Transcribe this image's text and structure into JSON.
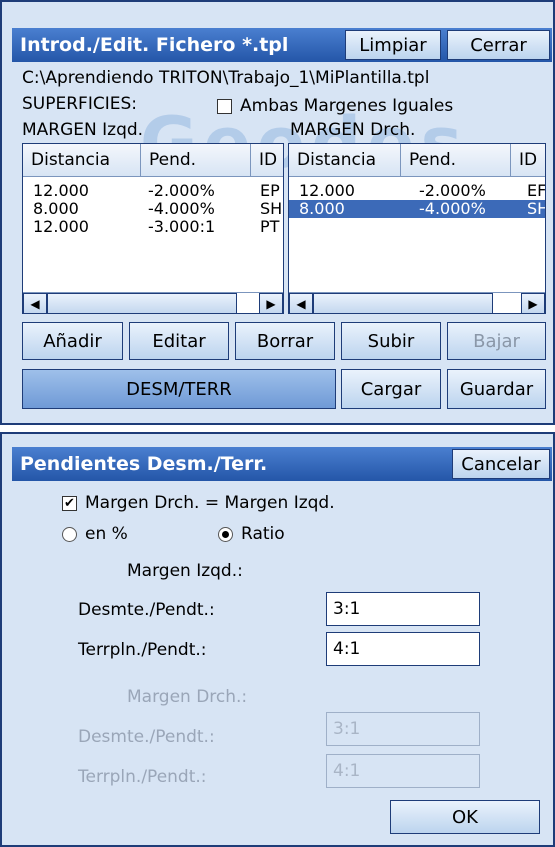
{
  "top_dialog": {
    "title": "Introd./Edit. Fichero *.tpl",
    "limpiar_label": "Limpiar",
    "cerrar_label": "Cerrar",
    "file_path": "C:\\Aprendiendo TRITON\\Trabajo_1\\MiPlantilla.tpl",
    "superficies_label": "SUPERFICIES:",
    "ambas_margenes_label": "Ambas Margenes Iguales",
    "ambas_margenes_checked": false,
    "watermark": "Geodes",
    "left_list": {
      "title": "MARGEN Izqd.",
      "columns": [
        "Distancia",
        "Pend.",
        "ID"
      ],
      "rows": [
        [
          "12.000",
          "-2.000%",
          "EP"
        ],
        [
          "8.000",
          "-4.000%",
          "SH"
        ],
        [
          "12.000",
          "-3.000:1",
          "PT"
        ]
      ]
    },
    "right_list": {
      "title": "MARGEN Drch.",
      "columns": [
        "Distancia",
        "Pend.",
        "ID"
      ],
      "rows": [
        [
          "12.000",
          "-2.000%",
          "EF"
        ],
        [
          "8.000",
          "-4.000%",
          "SH"
        ]
      ],
      "selected_row": 1
    },
    "buttons": {
      "anadir": "Añadir",
      "editar": "Editar",
      "borrar": "Borrar",
      "subir": "Subir",
      "bajar": "Bajar",
      "desm_terr": "DESM/TERR",
      "cargar": "Cargar",
      "guardar": "Guardar"
    }
  },
  "bottom_dialog": {
    "title": "Pendientes Desm./Terr.",
    "cancelar_label": "Cancelar",
    "margen_igual_label": "Margen Drch. = Margen Izqd.",
    "margen_igual_checked": true,
    "radio_percent_label": "en %",
    "radio_ratio_label": "Ratio",
    "selected_mode": "Ratio",
    "left_section_title": "Margen Izqd.:",
    "right_section_title": "Margen Drch.:",
    "desmte_label": "Desmte./Pendt.:",
    "terrpln_label": "Terrpln./Pendt.:",
    "left_desmte_value": "3:1",
    "left_terrpln_value": "4:1",
    "right_desmte_value": "3:1",
    "right_terrpln_value": "4:1",
    "ok_label": "OK"
  }
}
